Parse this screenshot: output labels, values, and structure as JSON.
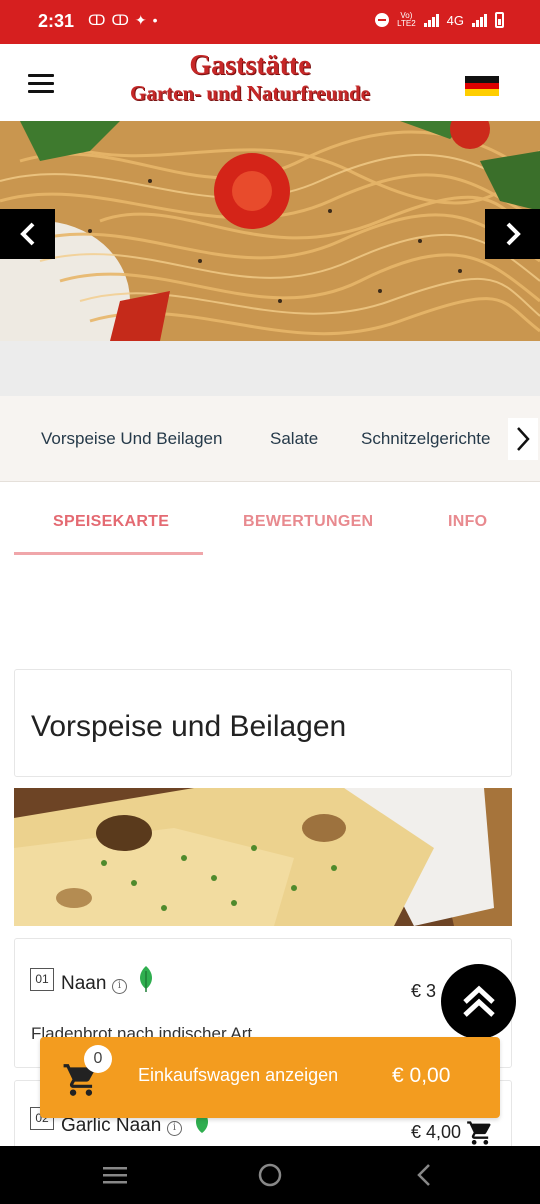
{
  "status_bar": {
    "time": "2:31",
    "network_type": "4G",
    "volte": "VoLTE2",
    "icons": [
      "sim-icon",
      "sim-icon",
      "sync-icon",
      "dot-icon",
      "do-not-disturb-icon",
      "signal-icon",
      "battery-icon"
    ]
  },
  "header": {
    "logo_line1": "Gaststätte",
    "logo_line2": "Garten- und Naturfreunde",
    "language_flag": "german-flag-icon"
  },
  "categories": [
    "Vorspeise Und Beilagen",
    "Salate",
    "Schnitzelgerichte"
  ],
  "tabs": [
    {
      "label": "SPEISEKARTE",
      "active": true
    },
    {
      "label": "BEWERTUNGEN",
      "active": false
    },
    {
      "label": "INFO",
      "active": false
    }
  ],
  "section": {
    "title": "Vorspeise und Beilagen"
  },
  "items": [
    {
      "number": "01",
      "name": "Naan",
      "price": "€ 3",
      "description": "Fladenbrot nach indischer Art",
      "vegetarian": true
    },
    {
      "number": "02",
      "name": "Garlic Naan",
      "price": "€ 4,00",
      "vegetarian": true
    }
  ],
  "cart": {
    "count": "0",
    "label": "Einkaufswagen anzeigen",
    "total": "€ 0,00"
  },
  "colors": {
    "status_bar": "#d61f1f",
    "brand_red": "#c62828",
    "tab_active": "#e46a72",
    "cart_orange": "#f39c1f"
  }
}
